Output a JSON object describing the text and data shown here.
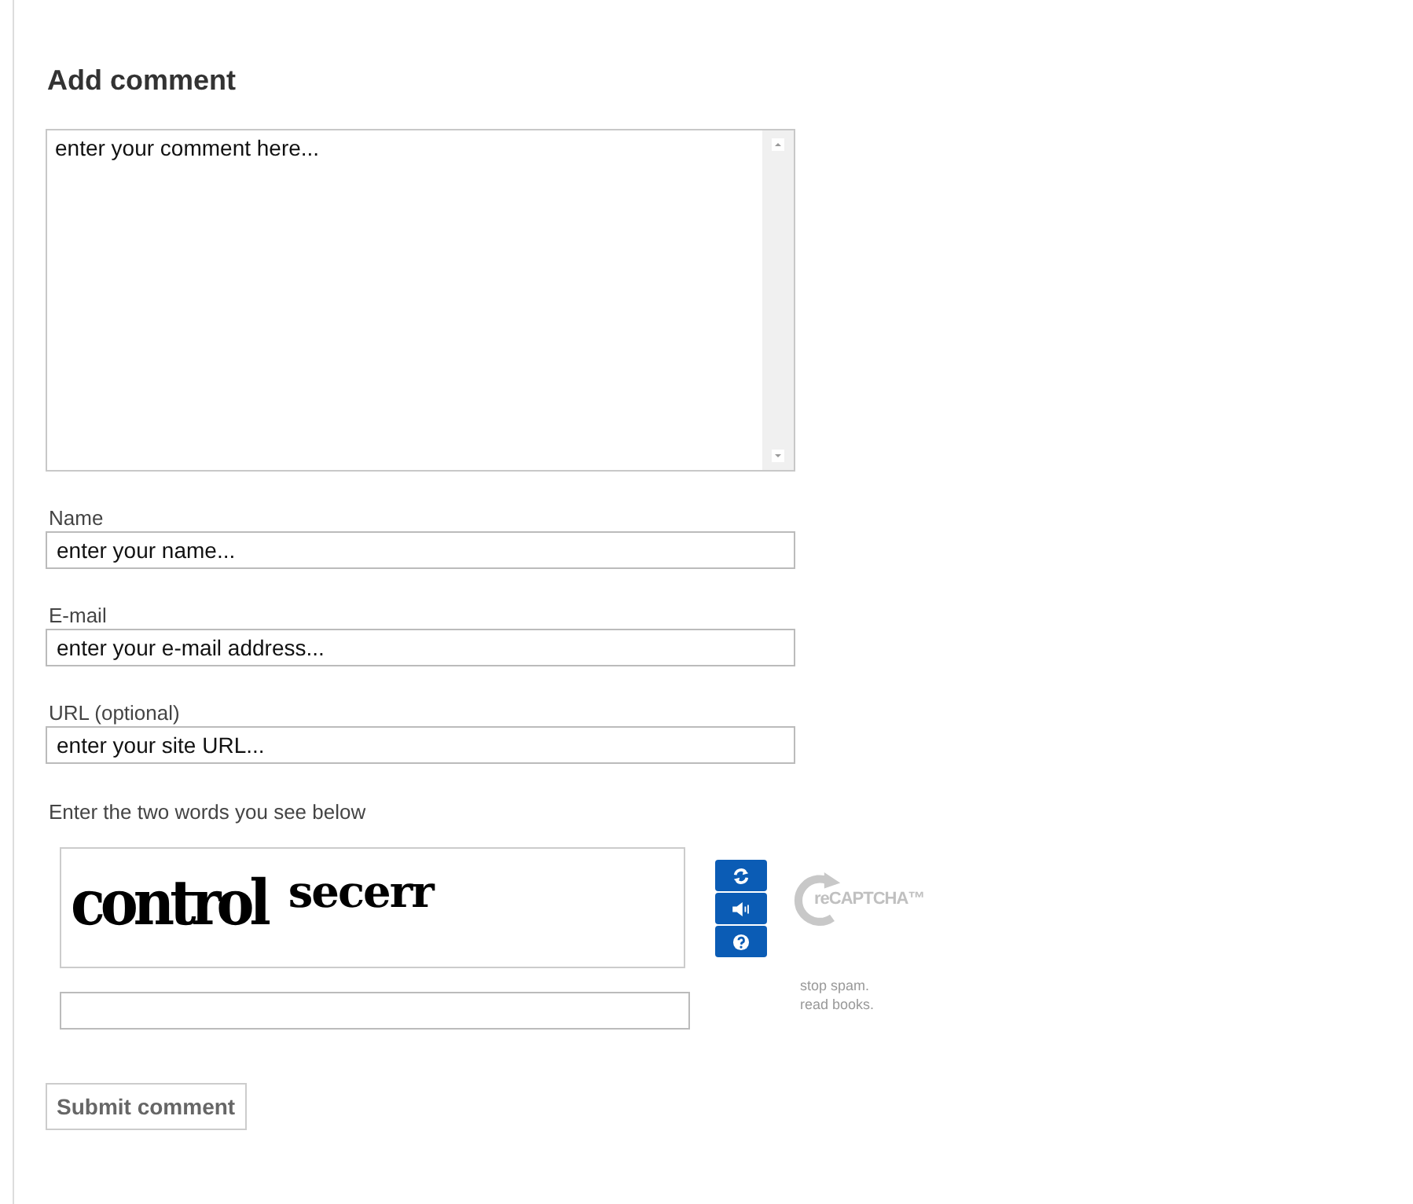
{
  "heading": "Add comment",
  "comment": {
    "placeholder": "enter your comment here..."
  },
  "fields": [
    {
      "label": "Name",
      "placeholder": "enter your name..."
    },
    {
      "label": "E-mail",
      "placeholder": "enter your e-mail address..."
    },
    {
      "label": "URL (optional)",
      "placeholder": "enter your site URL..."
    }
  ],
  "captcha": {
    "prompt": "Enter the two words you see below",
    "words": [
      "control",
      "secerr"
    ],
    "logo": "reCAPTCHA™",
    "slogan": [
      "stop spam.",
      "read books."
    ]
  },
  "submit": "Submit comment"
}
